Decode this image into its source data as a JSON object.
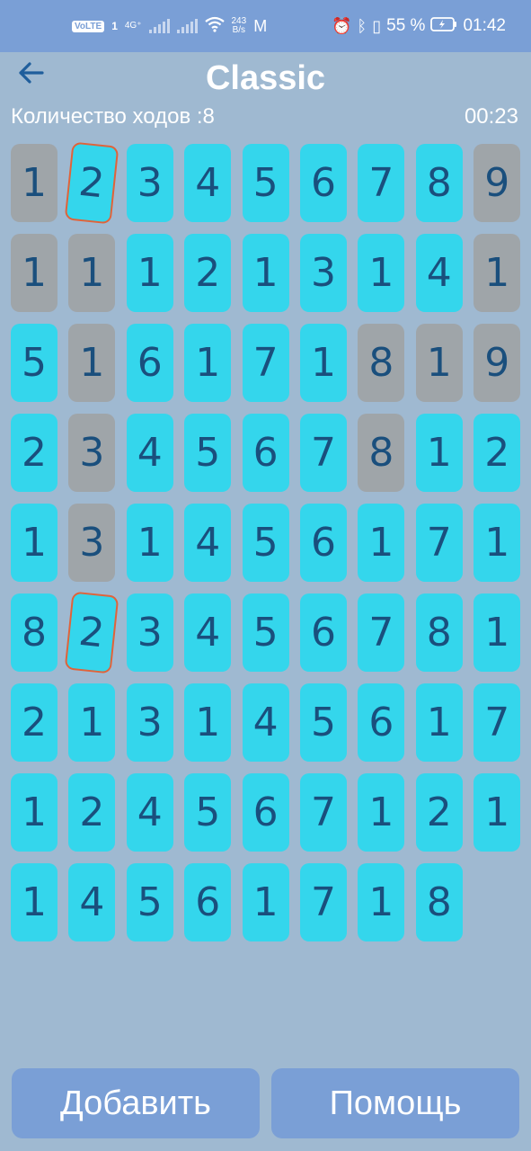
{
  "status_bar": {
    "volte": "VoLTE",
    "sim": "1",
    "net_type": "4G⁺",
    "speed_value": "243",
    "speed_unit": "B/s",
    "mail_icon": "M",
    "battery": "55 %",
    "time": "01:42"
  },
  "header": {
    "title": "Classic",
    "back_icon": "arrow-left-icon"
  },
  "info": {
    "moves": "Количество ходов :8",
    "timer": "00:23"
  },
  "board": {
    "rows": [
      [
        {
          "v": "1",
          "s": "used"
        },
        {
          "v": "2",
          "s": "selected"
        },
        {
          "v": "3",
          "s": "active"
        },
        {
          "v": "4",
          "s": "active"
        },
        {
          "v": "5",
          "s": "active"
        },
        {
          "v": "6",
          "s": "active"
        },
        {
          "v": "7",
          "s": "active"
        },
        {
          "v": "8",
          "s": "active"
        },
        {
          "v": "9",
          "s": "used"
        }
      ],
      [
        {
          "v": "1",
          "s": "used"
        },
        {
          "v": "1",
          "s": "used"
        },
        {
          "v": "1",
          "s": "active"
        },
        {
          "v": "2",
          "s": "active"
        },
        {
          "v": "1",
          "s": "active"
        },
        {
          "v": "3",
          "s": "active"
        },
        {
          "v": "1",
          "s": "active"
        },
        {
          "v": "4",
          "s": "active"
        },
        {
          "v": "1",
          "s": "used"
        }
      ],
      [
        {
          "v": "5",
          "s": "active"
        },
        {
          "v": "1",
          "s": "used"
        },
        {
          "v": "6",
          "s": "active"
        },
        {
          "v": "1",
          "s": "active"
        },
        {
          "v": "7",
          "s": "active"
        },
        {
          "v": "1",
          "s": "active"
        },
        {
          "v": "8",
          "s": "used"
        },
        {
          "v": "1",
          "s": "used"
        },
        {
          "v": "9",
          "s": "used"
        }
      ],
      [
        {
          "v": "2",
          "s": "active"
        },
        {
          "v": "3",
          "s": "used"
        },
        {
          "v": "4",
          "s": "active"
        },
        {
          "v": "5",
          "s": "active"
        },
        {
          "v": "6",
          "s": "active"
        },
        {
          "v": "7",
          "s": "active"
        },
        {
          "v": "8",
          "s": "used"
        },
        {
          "v": "1",
          "s": "active"
        },
        {
          "v": "2",
          "s": "active"
        }
      ],
      [
        {
          "v": "1",
          "s": "active"
        },
        {
          "v": "3",
          "s": "used"
        },
        {
          "v": "1",
          "s": "active"
        },
        {
          "v": "4",
          "s": "active"
        },
        {
          "v": "5",
          "s": "active"
        },
        {
          "v": "6",
          "s": "active"
        },
        {
          "v": "1",
          "s": "active"
        },
        {
          "v": "7",
          "s": "active"
        },
        {
          "v": "1",
          "s": "active"
        }
      ],
      [
        {
          "v": "8",
          "s": "active"
        },
        {
          "v": "2",
          "s": "selected"
        },
        {
          "v": "3",
          "s": "active"
        },
        {
          "v": "4",
          "s": "active"
        },
        {
          "v": "5",
          "s": "active"
        },
        {
          "v": "6",
          "s": "active"
        },
        {
          "v": "7",
          "s": "active"
        },
        {
          "v": "8",
          "s": "active"
        },
        {
          "v": "1",
          "s": "active"
        }
      ],
      [
        {
          "v": "2",
          "s": "active"
        },
        {
          "v": "1",
          "s": "active"
        },
        {
          "v": "3",
          "s": "active"
        },
        {
          "v": "1",
          "s": "active"
        },
        {
          "v": "4",
          "s": "active"
        },
        {
          "v": "5",
          "s": "active"
        },
        {
          "v": "6",
          "s": "active"
        },
        {
          "v": "1",
          "s": "active"
        },
        {
          "v": "7",
          "s": "active"
        }
      ],
      [
        {
          "v": "1",
          "s": "active"
        },
        {
          "v": "2",
          "s": "active"
        },
        {
          "v": "4",
          "s": "active"
        },
        {
          "v": "5",
          "s": "active"
        },
        {
          "v": "6",
          "s": "active"
        },
        {
          "v": "7",
          "s": "active"
        },
        {
          "v": "1",
          "s": "active"
        },
        {
          "v": "2",
          "s": "active"
        },
        {
          "v": "1",
          "s": "active"
        }
      ],
      [
        {
          "v": "1",
          "s": "active"
        },
        {
          "v": "4",
          "s": "active"
        },
        {
          "v": "5",
          "s": "active"
        },
        {
          "v": "6",
          "s": "active"
        },
        {
          "v": "1",
          "s": "active"
        },
        {
          "v": "7",
          "s": "active"
        },
        {
          "v": "1",
          "s": "active"
        },
        {
          "v": "8",
          "s": "active"
        }
      ]
    ]
  },
  "buttons": {
    "add": "Добавить",
    "help": "Помощь"
  },
  "colors": {
    "status_bar": "#7a9fd6",
    "background": "#9fb9d1",
    "cell_active": "#34d6ec",
    "cell_used": "#9fa5a9",
    "selected_border": "#e0633a",
    "digit": "#1a4f7d"
  }
}
